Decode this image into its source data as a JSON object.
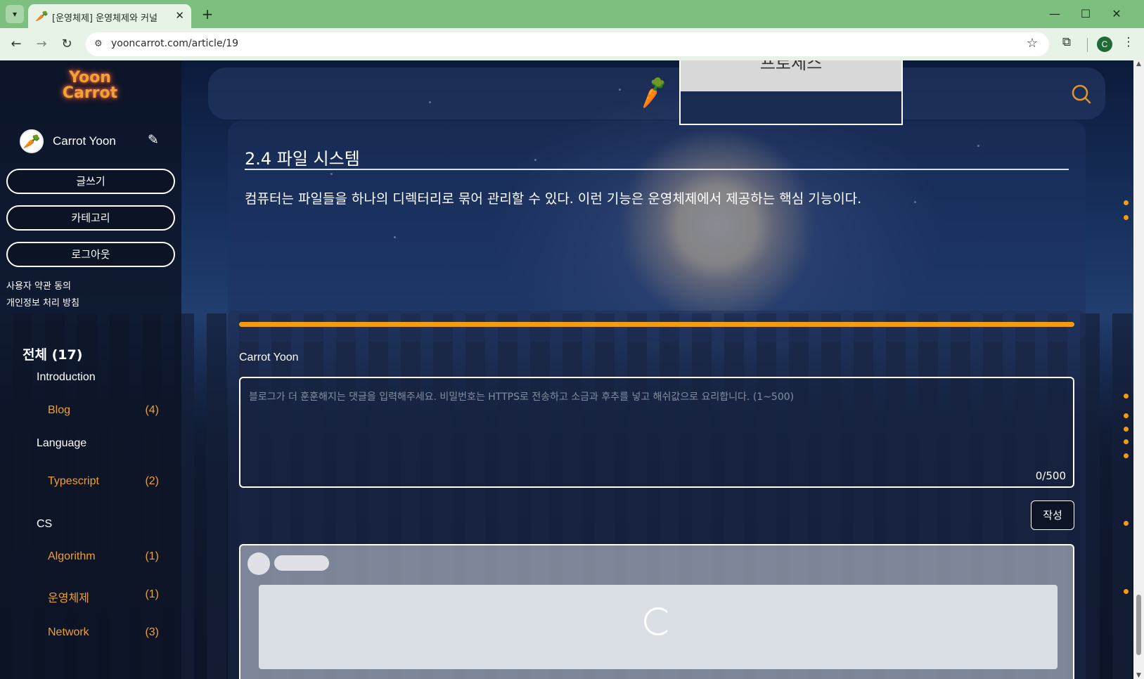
{
  "browser": {
    "tab_title": "[운영체제] 운영체제와 커널",
    "url": "yooncarrot.com/article/19",
    "profile_initial": "C",
    "tab_icon": "carrot-icon"
  },
  "sidebar": {
    "logo_line1": "Yoon",
    "logo_line2": "Carrot",
    "user_name": "Carrot Yoon",
    "buttons": [
      {
        "label": "글쓰기"
      },
      {
        "label": "카테고리"
      },
      {
        "label": "로그아웃"
      }
    ],
    "links": [
      {
        "label": "사용자 약관 동의"
      },
      {
        "label": "개인정보 처리 방침"
      }
    ],
    "category_total": "전체 (17)",
    "groups": [
      {
        "label": "Introduction",
        "items": [
          {
            "label": "Blog",
            "count": "(4)"
          }
        ]
      },
      {
        "label": "Language",
        "items": [
          {
            "label": "Typescript",
            "count": "(2)"
          }
        ]
      },
      {
        "label": "CS",
        "items": [
          {
            "label": "Algorithm",
            "count": "(1)"
          },
          {
            "label": "운영체제",
            "count": "(1)"
          },
          {
            "label": "Network",
            "count": "(3)"
          }
        ]
      }
    ]
  },
  "toc": {
    "heading": "프로세스"
  },
  "article": {
    "section_title": "2.4 파일 시스템",
    "paragraph": "컴퓨터는 파일들을 하나의 디렉터리로 묶어 관리할 수 있다. 이런 기능은 운영체제에서 제공하는 핵심 기능이다."
  },
  "comments": {
    "user_name": "Carrot Yoon",
    "placeholder": "블로그가 더 훈훈해지는 댓글을 입력해주세요. 비밀번호는 HTTPS로 전송하고 소금과 후추를 넣고 해쉬값으로 요리합니다. (1~500)",
    "char_count": "0/500",
    "submit_label": "작성"
  },
  "colors": {
    "accent": "#f39c12",
    "browser_frame": "#7cbf7e"
  }
}
